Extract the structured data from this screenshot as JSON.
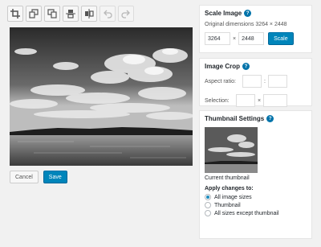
{
  "toolbar": {
    "buttons": [
      {
        "name": "crop",
        "icon": "crop-icon",
        "enabled": true
      },
      {
        "name": "rotate-left",
        "icon": "rotate-left-icon",
        "enabled": true
      },
      {
        "name": "rotate-right",
        "icon": "rotate-right-icon",
        "enabled": true
      },
      {
        "name": "flip-vertical",
        "icon": "flip-vertical-icon",
        "enabled": true
      },
      {
        "name": "flip-horizontal",
        "icon": "flip-horizontal-icon",
        "enabled": true
      },
      {
        "name": "undo",
        "icon": "undo-icon",
        "enabled": false
      },
      {
        "name": "redo",
        "icon": "redo-icon",
        "enabled": false
      }
    ]
  },
  "actions": {
    "cancel_label": "Cancel",
    "save_label": "Save"
  },
  "scale": {
    "title": "Scale Image",
    "original_text": "Original dimensions 3264 × 2448",
    "width": "3264",
    "separator": "×",
    "height": "2448",
    "button_label": "Scale"
  },
  "crop": {
    "title": "Image Crop",
    "aspect_label": "Aspect ratio:",
    "aspect_sep": ":",
    "selection_label": "Selection:",
    "selection_sep": "×"
  },
  "thumb": {
    "title": "Thumbnail Settings",
    "caption": "Current thumbnail",
    "apply_label": "Apply changes to:",
    "options": [
      {
        "label": "All image sizes",
        "checked": true
      },
      {
        "label": "Thumbnail",
        "checked": false
      },
      {
        "label": "All sizes except thumbnail",
        "checked": false
      }
    ]
  },
  "colors": {
    "primary": "#0085ba",
    "help": "#0073aa",
    "radio_checked": "#1e8cbe"
  }
}
